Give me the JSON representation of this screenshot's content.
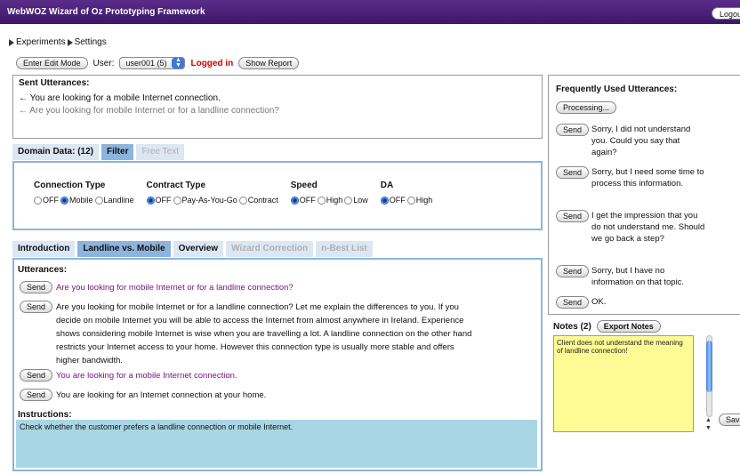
{
  "app": {
    "title": "WebWOZ Wizard of Oz Prototyping Framework",
    "logout": "Logout"
  },
  "menu": {
    "experiments": "Experiments",
    "settings": "Settings"
  },
  "controls": {
    "edit_mode": "Enter Edit Mode",
    "user_label": "User:",
    "user_value": "user001 (5)",
    "status": "Logged in",
    "show_report": "Show Report"
  },
  "sent": {
    "title": "Sent Utterances:",
    "items": [
      "← You are looking for a mobile Internet connection.",
      "← Are you looking for mobile Internet or for a landline connection?"
    ]
  },
  "domain_tabs": [
    {
      "label": "Domain Data: (12)"
    },
    {
      "label": "Filter"
    },
    {
      "label": "Free Text"
    }
  ],
  "filters": [
    {
      "label": "Connection Type",
      "options": [
        "OFF",
        "Mobile",
        "Landline"
      ],
      "selected": 1
    },
    {
      "label": "Contract Type",
      "options": [
        "OFF",
        "Pay-As-You-Go",
        "Contract"
      ],
      "selected": 0
    },
    {
      "label": "Speed",
      "options": [
        "OFF",
        "High",
        "Low"
      ],
      "selected": 0
    },
    {
      "label": "DA",
      "options": [
        "OFF",
        "High"
      ],
      "selected": 0
    }
  ],
  "main_tabs": [
    {
      "label": "Introduction"
    },
    {
      "label": "Landline vs. Mobile"
    },
    {
      "label": "Overview"
    },
    {
      "label": "Wizard Correction"
    },
    {
      "label": "n-Best List"
    }
  ],
  "utterances": {
    "title": "Utterances:",
    "send_label": "Send",
    "items": [
      "Are you looking for mobile Internet or for a landline connection?",
      "Are you looking for mobile Internet or for a landline connection? Let me explain the differences to you. If you decide on mobile Internet you will be able to access the Internet from almost anywhere in Ireland. Experience shows considering mobile Internet is wise when you are travelling a lot. A landline connection on the other hand restricts your Internet access to your home. However this connection type is usually more stable and offers higher bandwidth.",
      "You are looking for a mobile Internet connection.",
      "You are looking for an Internet connection at your home."
    ]
  },
  "instructions": {
    "title": "Instructions:",
    "text": "Check whether the customer prefers a landline connection or mobile Internet."
  },
  "frequent": {
    "title": "Frequently Used Utterances:",
    "processing": "Processing...",
    "send_label": "Send",
    "items": [
      "Sorry, I did not understand you. Could you say that again?",
      "Sorry, but I need some time to process this information.",
      "I get the impression that you do not understand me. Should we go back a step?",
      "Sorry, but I have no information on that topic.",
      "OK."
    ]
  },
  "notes": {
    "title": "Notes (2)",
    "export": "Export Notes",
    "text": "Client does not understand the meaning of landline connection!",
    "save": "Save"
  }
}
